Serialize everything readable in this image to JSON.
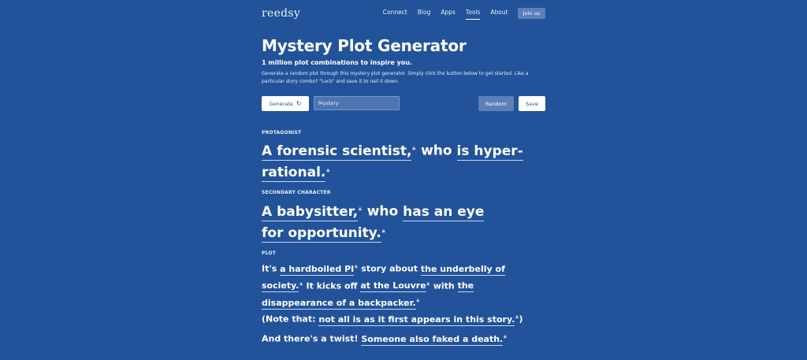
{
  "nav": {
    "logo": "reedsy",
    "links": [
      "Connect",
      "Blog",
      "Apps",
      "Tools",
      "About"
    ],
    "join_label": "Join us"
  },
  "header": {
    "title": "Mystery Plot Generator",
    "subtitle": "1 million plot combinations to inspire you.",
    "description": "Generate a random plot through this mystery plot generator. Simply click the button below to get started. Like a particular story combo? \"Lock\" and save it to nail it down."
  },
  "controls": {
    "generate_label": "Generate",
    "genre_value": "Mystery",
    "random_label": "Random",
    "save_label": "Save"
  },
  "protagonist": {
    "label": "PROTAGONIST",
    "character": "A forensic scientist,",
    "connector": "who",
    "trait": "is hyper-rational."
  },
  "secondary": {
    "label": "SECONDARY CHARACTER",
    "character": "A babysitter,",
    "connector": "who",
    "trait": "has an eye for opportunity."
  },
  "plot": {
    "label": "PLOT",
    "p1_a": "It's",
    "subgenre": "a hardboiled PI",
    "p1_b": "story about",
    "theme": "the underbelly of society.",
    "p1_c": "It kicks off",
    "setting": "at the Louvre",
    "p1_d": "with",
    "inciting": "the disappearance of a backpacker.",
    "note_a": "(Note that:",
    "note": "not all is as it first appears in this story.",
    "note_b": ")",
    "twist_a": "And there's a twist!",
    "twist": "Someone also faked a death."
  },
  "colors": {
    "background": "#22539a",
    "button_secondary": "#5b7fb8",
    "text": "#ffffff"
  },
  "icons": {
    "refresh": "refresh-icon",
    "lock": "lock-icon"
  }
}
